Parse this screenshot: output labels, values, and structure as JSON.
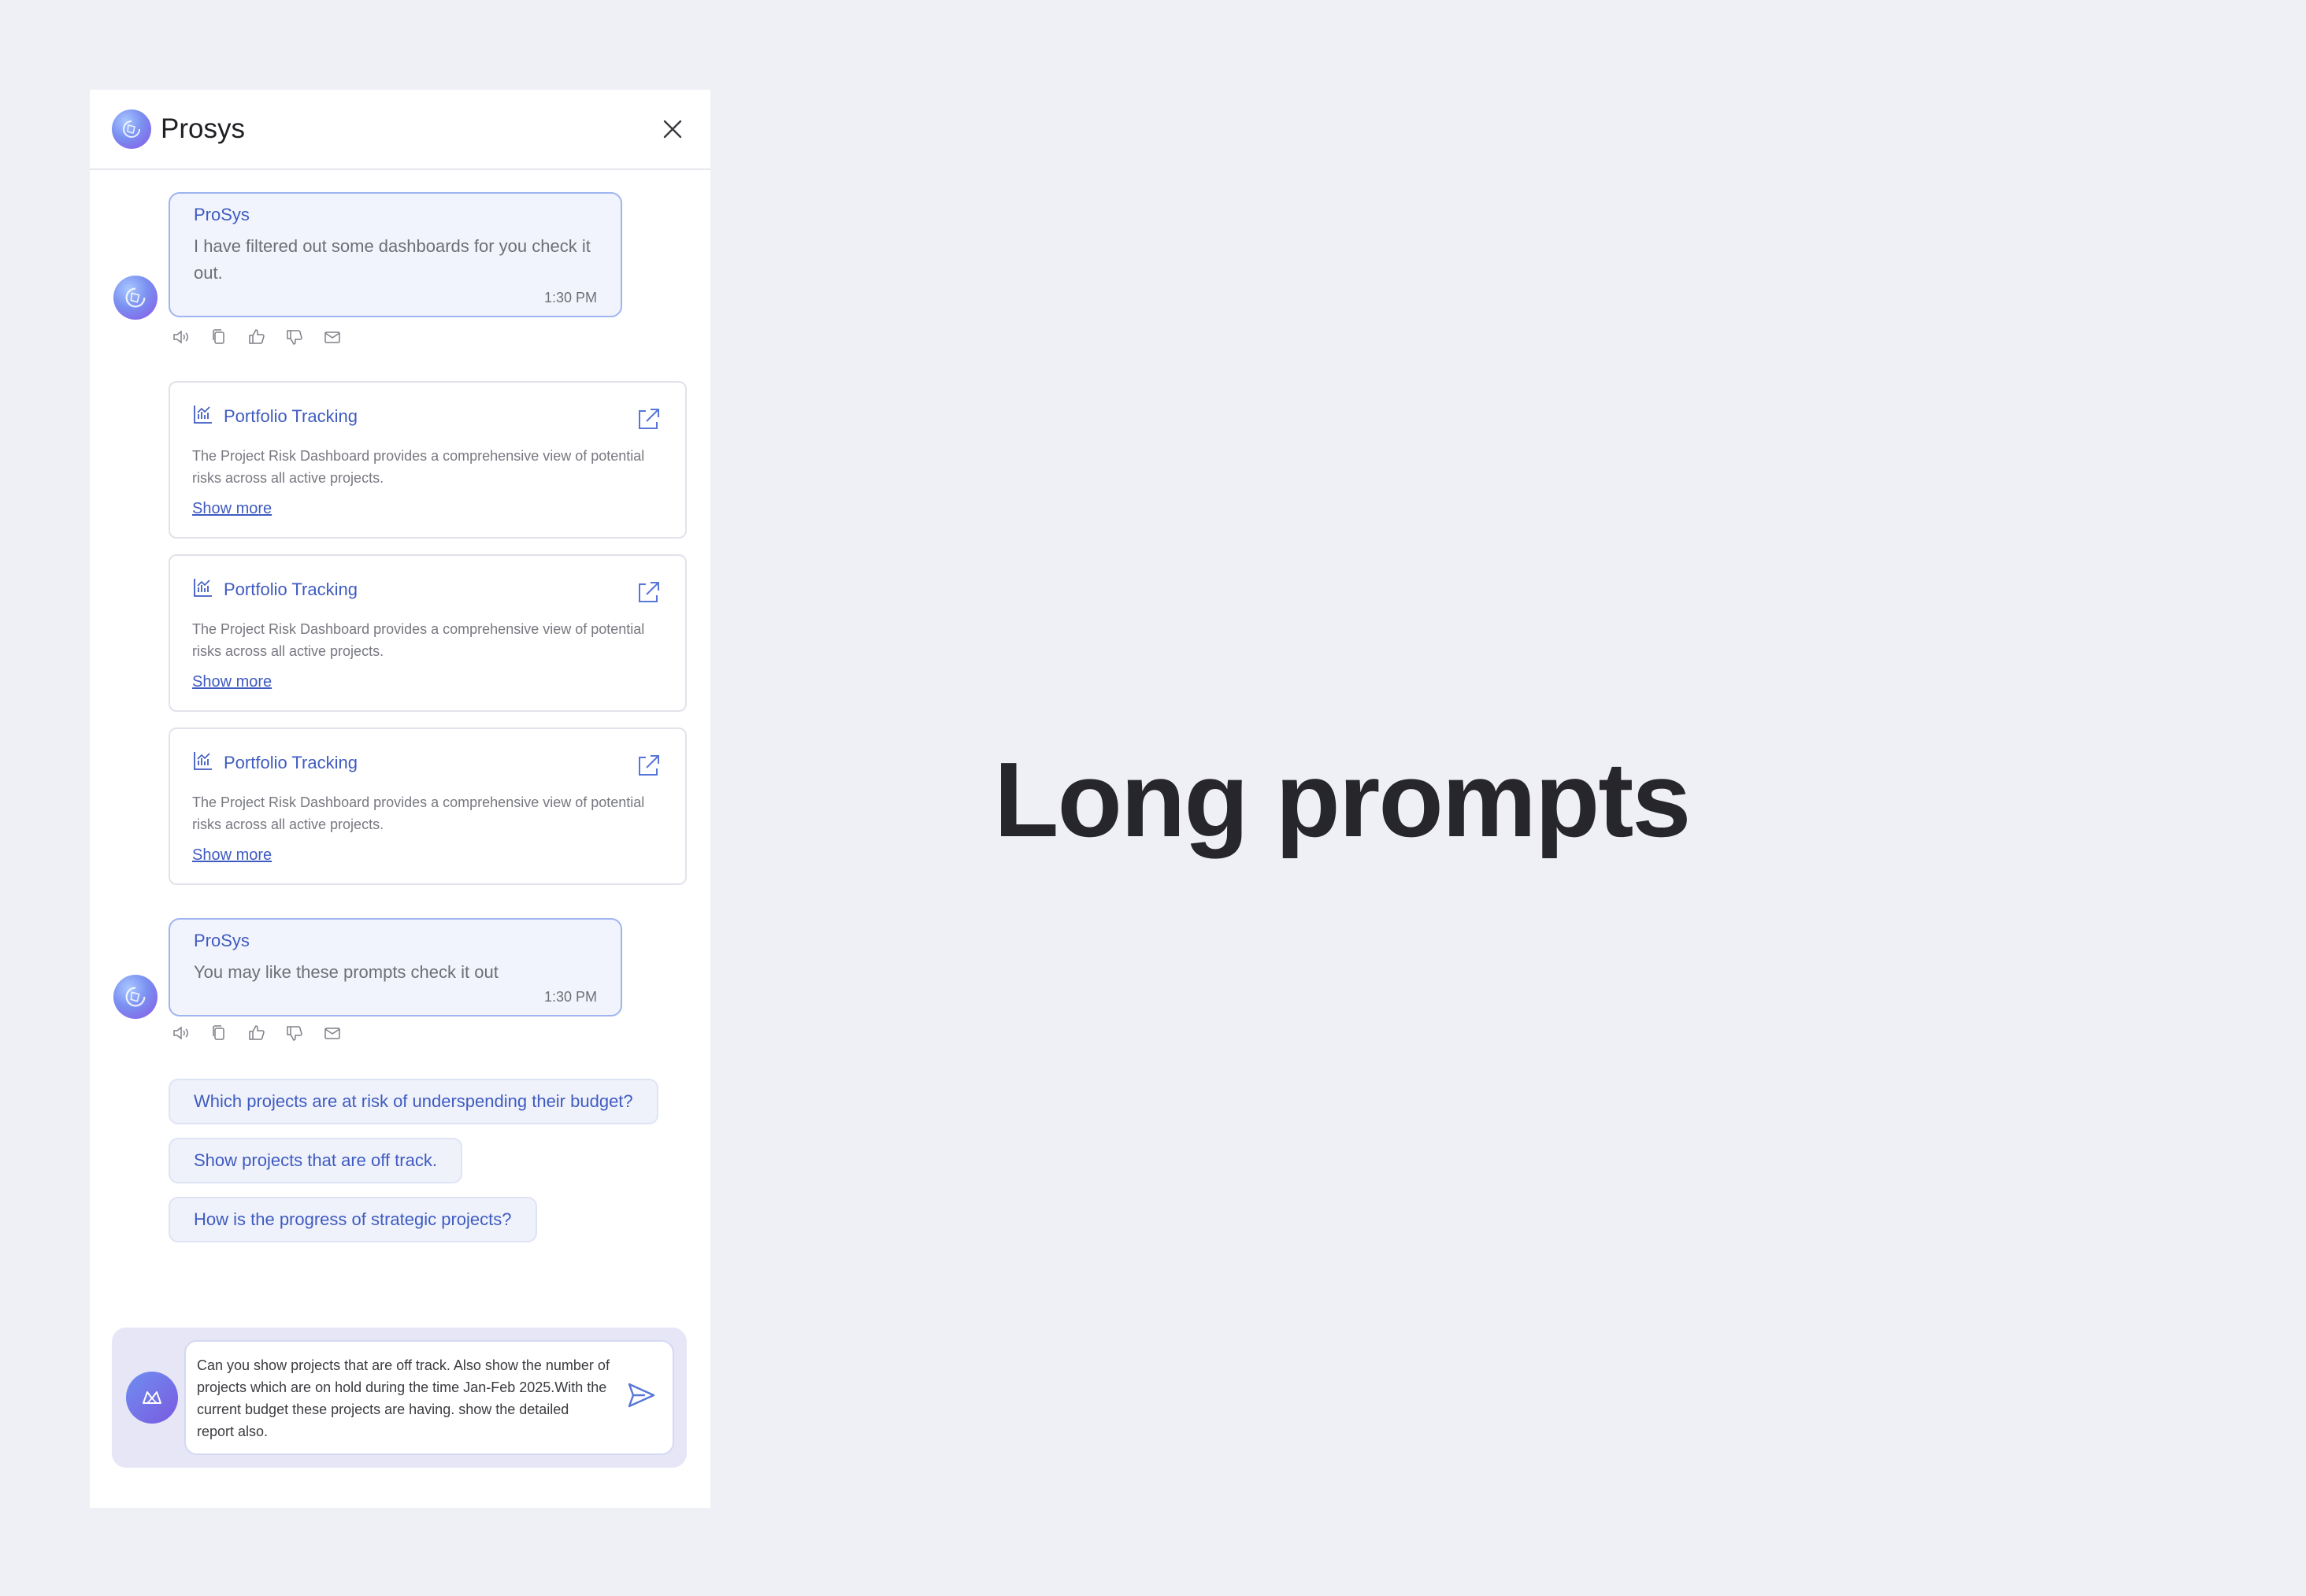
{
  "header": {
    "brand": "Prosys"
  },
  "messages": [
    {
      "sender": "ProSys",
      "text": "I have filtered out some dashboards for you check it out.",
      "time": "1:30 PM"
    },
    {
      "sender": "ProSys",
      "text": "You may like these prompts check it out",
      "time": "1:30 PM"
    }
  ],
  "dashboards": [
    {
      "title": "Portfolio Tracking",
      "description": "The Project Risk Dashboard provides a comprehensive view of potential risks across all active projects.",
      "link": "Show more"
    },
    {
      "title": "Portfolio Tracking",
      "description": "The Project Risk Dashboard provides a comprehensive view of potential risks across all active projects.",
      "link": "Show more"
    },
    {
      "title": "Portfolio Tracking",
      "description": "The Project Risk Dashboard provides a comprehensive view of potential risks across all active projects.",
      "link": "Show more"
    }
  ],
  "suggestions": [
    "Which projects are at risk of underspending their budget?",
    "Show projects that are off track.",
    "How is the progress of strategic projects?"
  ],
  "composer": {
    "value": "Can you show projects that are off track. Also show the number of projects which are on hold during the time Jan-Feb 2025.With the current budget these projects are having. show the detailed report also."
  },
  "hero": {
    "text": "Long prompts"
  },
  "icons": {
    "logo": "prosys-logo-icon",
    "close": "close-icon",
    "speaker": "speaker-icon",
    "copy": "copy-icon",
    "like": "thumbs-up-icon",
    "dislike": "thumbs-down-icon",
    "mail": "mail-icon",
    "chart": "chart-icon",
    "external": "external-link-icon",
    "send": "send-icon",
    "bot": "bot-icon"
  },
  "colors": {
    "accent": "#3f5bc0",
    "background": "#eff0f5",
    "bubble": "#f2f4fd"
  }
}
